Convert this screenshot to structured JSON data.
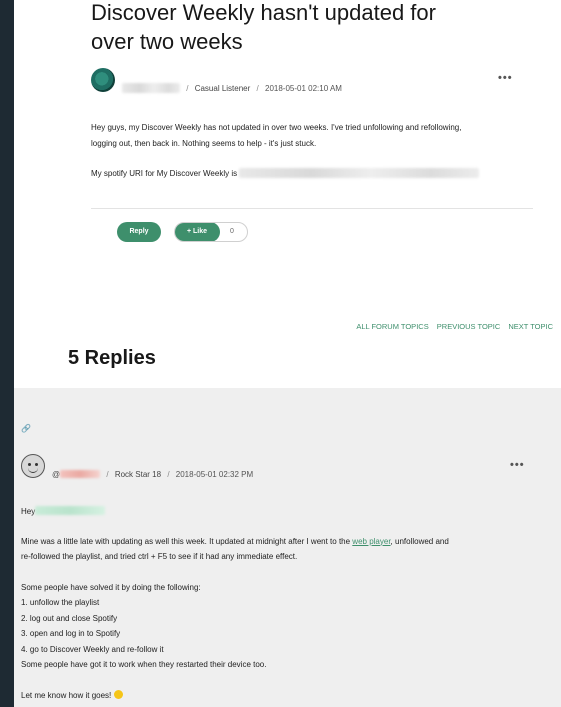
{
  "post": {
    "title_line1": "Discover Weekly hasn't updated for",
    "title_line2": "over two weeks",
    "author_rank": "Casual Listener",
    "date": "2018-05-01 02:10 AM",
    "body_line1": "Hey guys, my Discover Weekly has not updated in over two weeks. I've tried unfollowing and refollowing,",
    "body_line2": "logging out, then back in. Nothing seems to help - it's just stuck.",
    "uri_label": "My spotify URI for My Discover Weekly is",
    "reply_label": "Reply",
    "like_label": "+ Like",
    "like_count": "0",
    "more_icon": "more-dots-icon"
  },
  "forum_nav": {
    "all_topics": "ALL FORUM TOPICS",
    "previous": "PREVIOUS TOPIC",
    "next": "NEXT TOPIC"
  },
  "replies_heading": "5 Replies",
  "reply": {
    "link_icon": "link-icon",
    "rank": "Rock Star 18",
    "date": "2018-05-01 02:32 PM",
    "greeting": "Hey",
    "para1_before_link": "Mine was a little late with updating as well this week. It updated at midnight after I went to the ",
    "para1_link": "web player",
    "para1_after_link": ", unfollowed and",
    "para1_line2": "re-followed the playlist, and tried ctrl + F5 to see if it had any immediate effect.",
    "solved_intro": "Some people have solved it by doing the following:",
    "steps": [
      "1. unfollow the playlist",
      "2. log out and close Spotify",
      "3. open and log in to Spotify",
      "4. go to Discover Weekly and re-follow it"
    ],
    "restart_note": "Some people have got it to work when they restarted their device too.",
    "closing": "Let me know how it goes!"
  }
}
